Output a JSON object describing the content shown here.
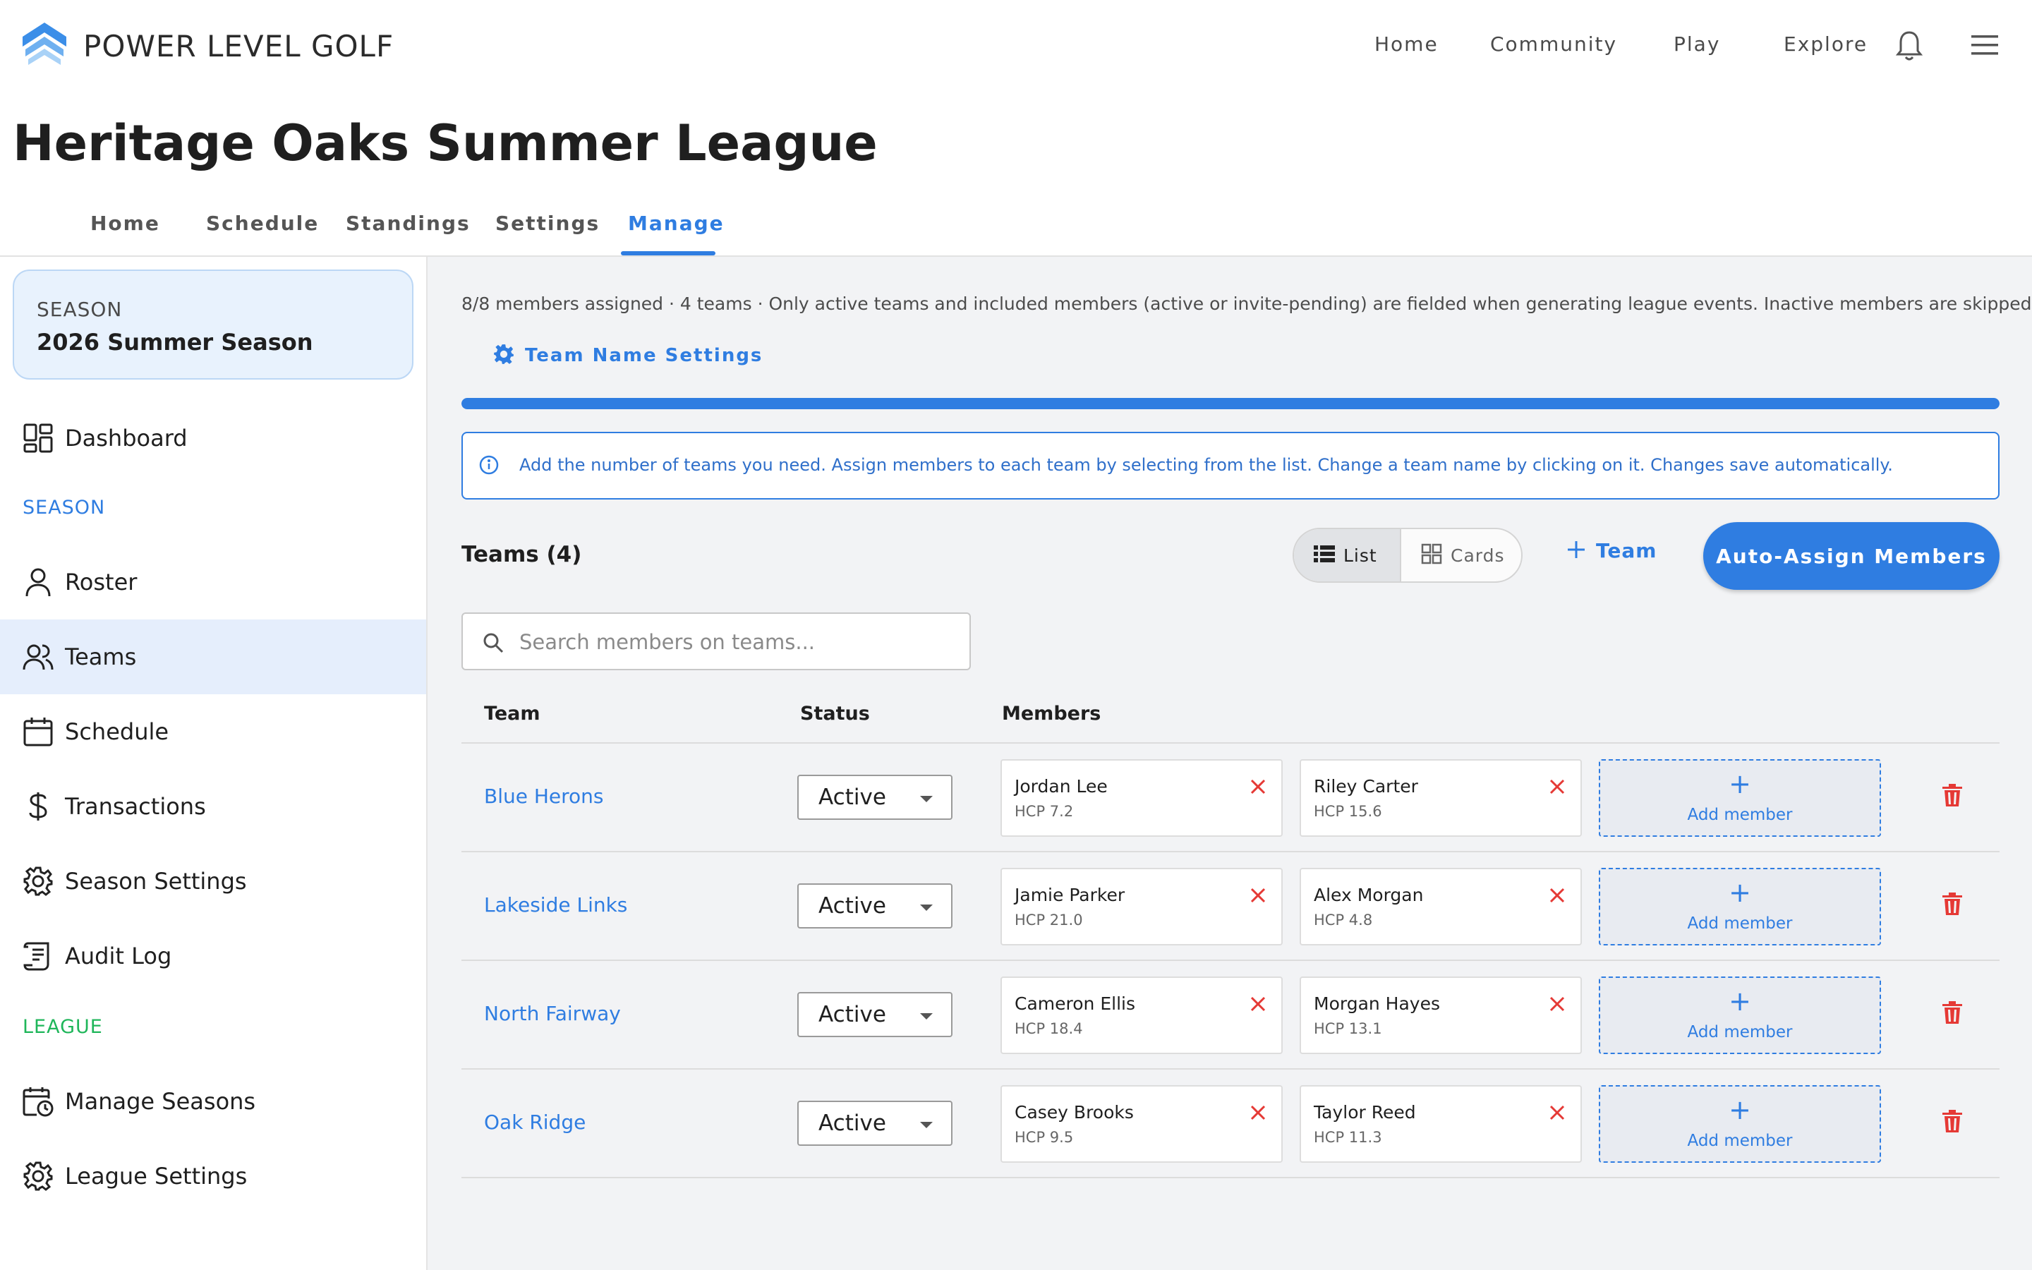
{
  "app": {
    "brand": "POWER LEVEL GOLF",
    "nav": [
      "Home",
      "Community",
      "Play",
      "Explore"
    ],
    "colors": {
      "accent": "#2f7de1",
      "danger": "#e53935",
      "league_green": "#1fb65a"
    }
  },
  "page": {
    "title": "Heritage Oaks Summer League",
    "tabs": [
      "Home",
      "Schedule",
      "Standings",
      "Settings",
      "Manage"
    ],
    "active_tab": "Manage"
  },
  "sidebar": {
    "season_label": "SEASON",
    "season_name": "2026 Summer Season",
    "dashboard": "Dashboard",
    "season_section": "SEASON",
    "season_items": [
      "Roster",
      "Teams",
      "Schedule",
      "Transactions",
      "Season Settings",
      "Audit Log"
    ],
    "active_item": "Teams",
    "league_section": "LEAGUE",
    "league_items": [
      "Manage Seasons",
      "League Settings"
    ]
  },
  "main": {
    "summary": "8/8 members assigned · 4 teams · Only active teams and included members (active or invite-pending) are fielded when generating league events. Inactive members are skipped.",
    "team_name_settings": "Team Name Settings",
    "assigned_fraction": 1.0,
    "info": "Add the number of teams you need. Assign members to each team by selecting from the list. Change a team name by clicking on it. Changes save automatically.",
    "teams_title": "Teams (4)",
    "view_list": "List",
    "view_cards": "Cards",
    "add_team": "Team",
    "auto_assign": "Auto-Assign Members",
    "search_placeholder": "Search members on teams...",
    "columns": {
      "team": "Team",
      "status": "Status",
      "members": "Members"
    },
    "add_member": "Add member",
    "teams": [
      {
        "name": "Blue Herons",
        "status": "Active",
        "members": [
          {
            "name": "Jordan Lee",
            "hcp": "HCP 7.2"
          },
          {
            "name": "Riley Carter",
            "hcp": "HCP 15.6"
          }
        ]
      },
      {
        "name": "Lakeside Links",
        "status": "Active",
        "members": [
          {
            "name": "Jamie Parker",
            "hcp": "HCP 21.0"
          },
          {
            "name": "Alex Morgan",
            "hcp": "HCP 4.8"
          }
        ]
      },
      {
        "name": "North Fairway",
        "status": "Active",
        "members": [
          {
            "name": "Cameron Ellis",
            "hcp": "HCP 18.4"
          },
          {
            "name": "Morgan Hayes",
            "hcp": "HCP 13.1"
          }
        ]
      },
      {
        "name": "Oak Ridge",
        "status": "Active",
        "members": [
          {
            "name": "Casey Brooks",
            "hcp": "HCP 9.5"
          },
          {
            "name": "Taylor Reed",
            "hcp": "HCP 11.3"
          }
        ]
      }
    ]
  }
}
